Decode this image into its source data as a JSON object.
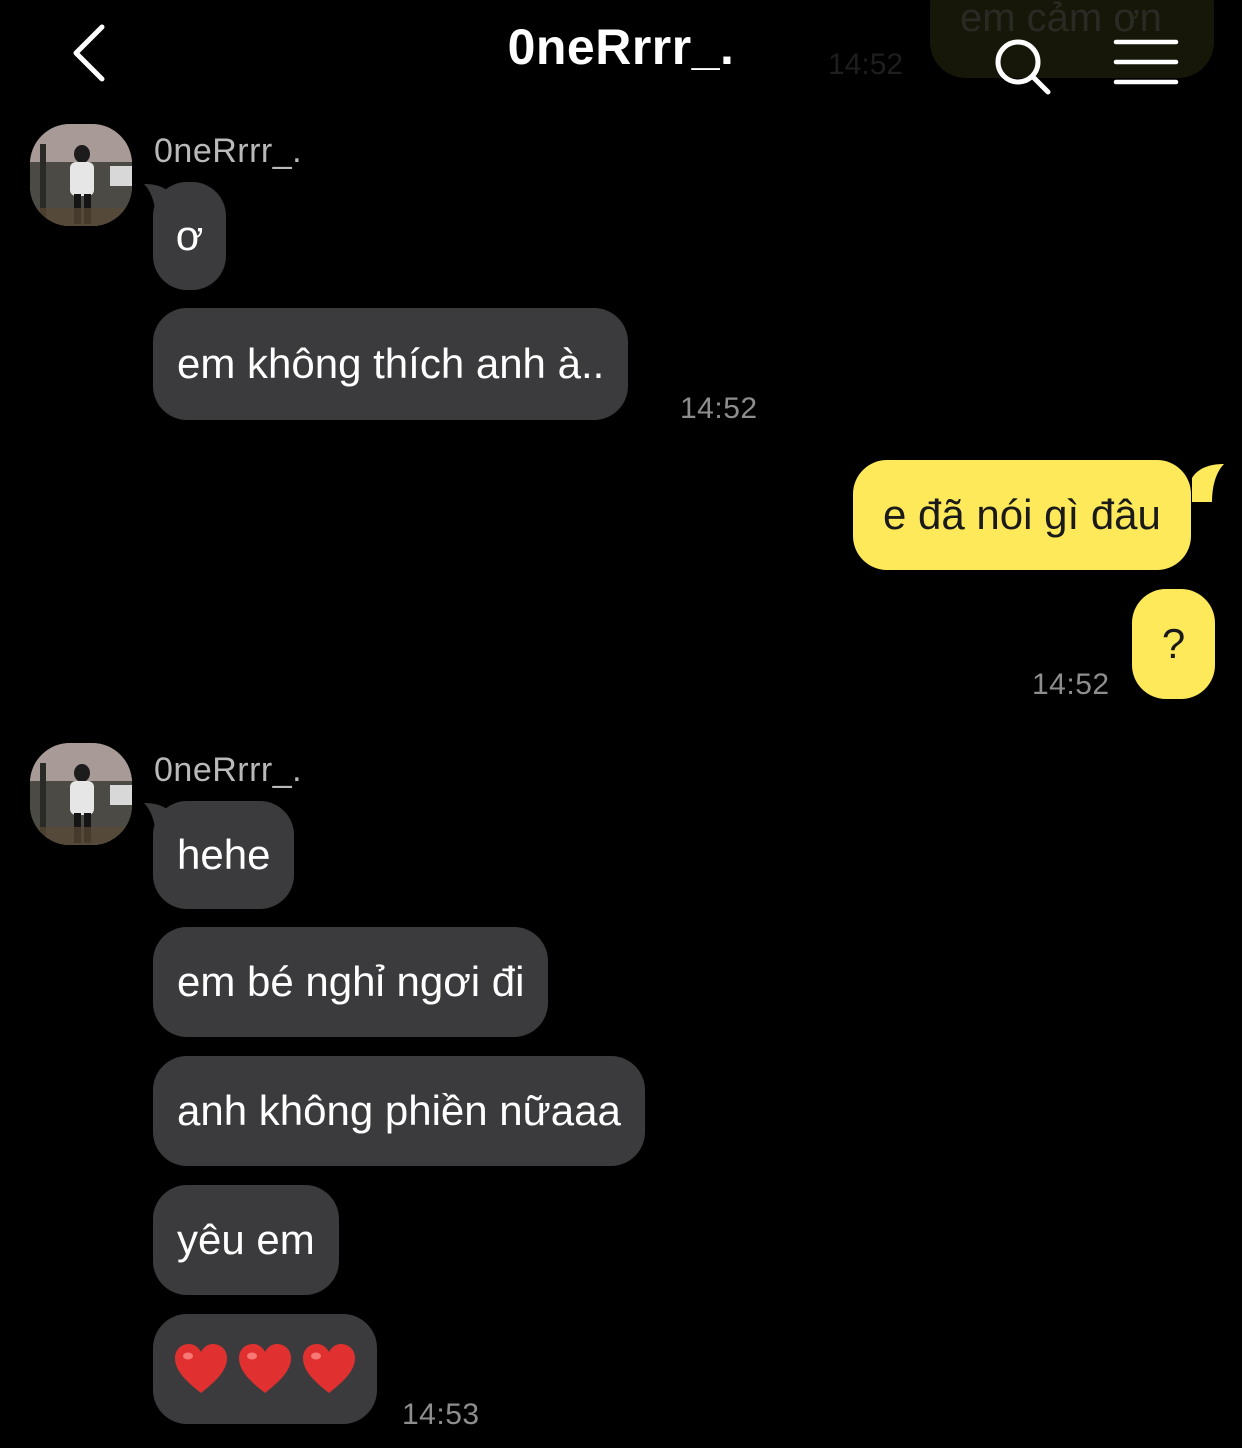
{
  "header": {
    "title": "0neRrrr_.",
    "back_icon": "chevron-left-icon",
    "search_icon": "search-icon",
    "menu_icon": "menu-icon",
    "prev_message": "em cảm ơn",
    "prev_time": "14:52"
  },
  "groups": [
    {
      "sender": "0neRrrr_.",
      "messages": [
        "ơ",
        "em không thích anh à.."
      ],
      "time": "14:52"
    },
    {
      "sender": "me",
      "messages": [
        "e đã nói gì đâu",
        "?"
      ],
      "time": "14:52"
    },
    {
      "sender": "0neRrrr_.",
      "messages": [
        "hehe",
        "em bé nghỉ ngơi đi",
        "anh không phiền nữaaa",
        "yêu em",
        "❤️❤️❤️"
      ],
      "time": "14:53"
    }
  ],
  "colors": {
    "background": "#000000",
    "incoming_bubble": "#3b3b3d",
    "outgoing_bubble": "#fde95a",
    "timestamp": "#8e8e8e",
    "heart": "#e0302f"
  }
}
